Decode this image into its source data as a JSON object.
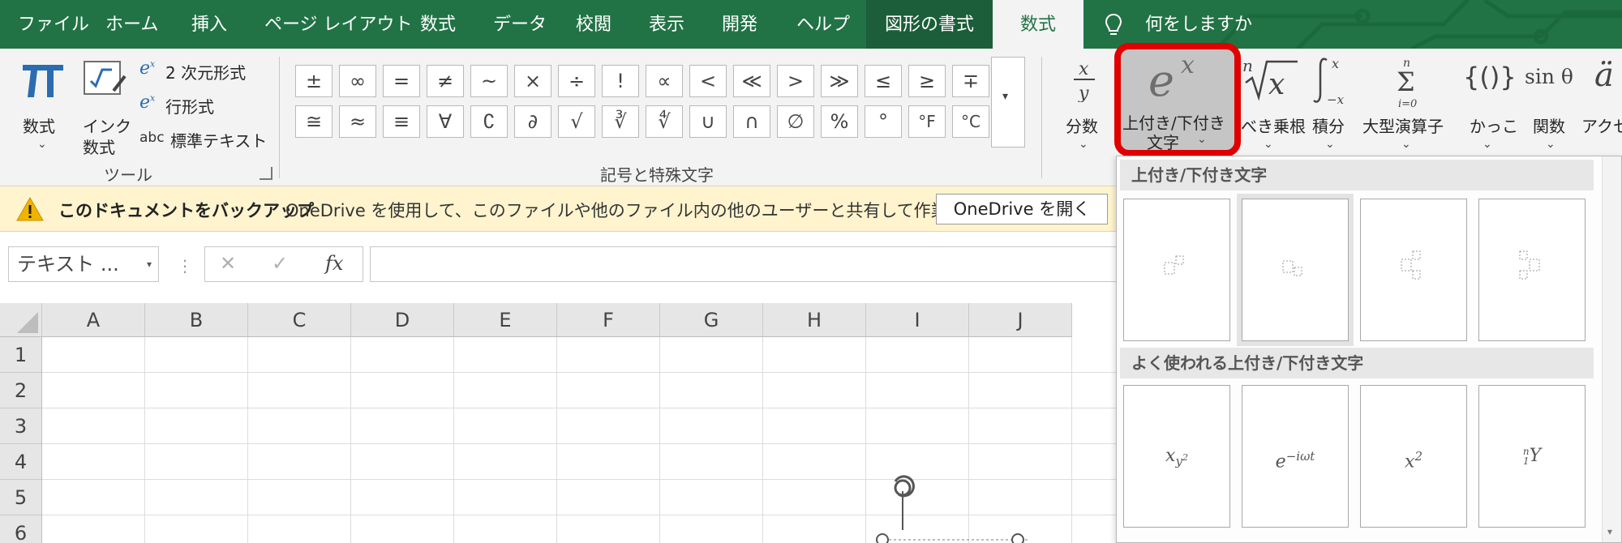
{
  "menu": {
    "tabs": [
      "ファイル",
      "ホーム",
      "挿入",
      "ページ レイアウト",
      "数式",
      "データ",
      "校閲",
      "表示",
      "開発",
      "ヘルプ"
    ],
    "shape_format": "図形の書式",
    "active_tab": "数式",
    "tell_me": "何をしますか"
  },
  "tools": {
    "equation_label": "数式",
    "ink_label_1": "インク",
    "ink_label_2": "数式",
    "professional": "2 次元形式",
    "linear": "行形式",
    "normal_prefix": "abc",
    "normal_text": "標準テキスト",
    "group_title": "ツール"
  },
  "symbols": {
    "row1": [
      "±",
      "∞",
      "=",
      "≠",
      "~",
      "×",
      "÷",
      "!",
      "∝",
      "<",
      "≪",
      ">",
      "≫",
      "≤",
      "≥",
      "∓"
    ],
    "row2": [
      "≅",
      "≈",
      "≡",
      "∀",
      "∁",
      "∂",
      "√",
      "∛",
      "∜",
      "∪",
      "∩",
      "∅",
      "%",
      "°",
      "°F",
      "°C"
    ],
    "group_title": "記号と特殊文字"
  },
  "structures": {
    "fraction": "分数",
    "script_1": "上付き/下付き",
    "script_2": "文字",
    "radical": "べき乗根",
    "integral": "積分",
    "large_operator": "大型演算子",
    "bracket": "かっこ",
    "function": "関数",
    "accent": "アクセ"
  },
  "infobar": {
    "title": "このドキュメントをバックアップ",
    "message": "OneDrive を使用して、このファイルや他のファイル内の他のユーザーと共有して作業します。",
    "button": "OneDrive を開く"
  },
  "formula_bar": {
    "name_box": "テキスト ...",
    "cancel": "✕",
    "enter": "✓",
    "fx": "fx"
  },
  "columns": [
    "A",
    "B",
    "C",
    "D",
    "E",
    "F",
    "G",
    "H",
    "I",
    "J"
  ],
  "rows": [
    "1",
    "2",
    "3",
    "4",
    "5",
    "6"
  ],
  "gallery": {
    "section1": "上付き/下付き文字",
    "section2": "よく使われる上付き/下付き文字",
    "common": [
      "x_{y²}",
      "e^{−iωt}",
      "x²",
      "ⁿ₁Y"
    ]
  },
  "colors": {
    "menubar": "#217346",
    "highlight": "#e00000",
    "infobar": "#fff4ce"
  }
}
